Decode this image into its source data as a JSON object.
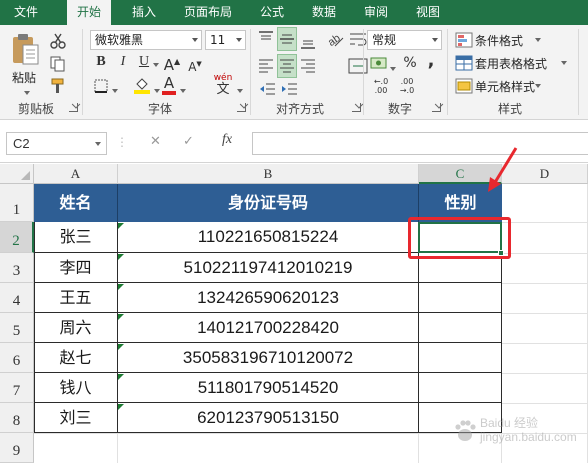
{
  "ribbon_tabs": [
    "文件",
    "开始",
    "插入",
    "页面布局",
    "公式",
    "数据",
    "审阅",
    "视图"
  ],
  "active_tab": "开始",
  "clipboard": {
    "paste": "粘贴",
    "group": "剪贴板"
  },
  "font": {
    "name": "微软雅黑",
    "size": "11",
    "bold": "B",
    "italic": "I",
    "underline": "U",
    "grow": "A",
    "shrink": "A",
    "wen": "wén",
    "wen_char": "文",
    "group": "字体"
  },
  "alignment": {
    "group": "对齐方式"
  },
  "number": {
    "format": "常规",
    "percent": "%",
    "comma": ",",
    "group": "数字"
  },
  "styles": {
    "conditional": "条件格式",
    "table": "套用表格格式",
    "cell": "单元格样式",
    "group": "样式"
  },
  "name_box": "C2",
  "formula_buttons": {
    "cancel": "✕",
    "enter": "✓",
    "fx": "fx"
  },
  "columns": [
    "A",
    "B",
    "C",
    "D"
  ],
  "rows": [
    "1",
    "2",
    "3",
    "4",
    "5",
    "6",
    "7",
    "8",
    "9"
  ],
  "table": {
    "headers": [
      "姓名",
      "身份证号码",
      "性别"
    ],
    "records": [
      {
        "name": "张三",
        "id": "110221650815224",
        "gender": ""
      },
      {
        "name": "李四",
        "id": "510221197412010219",
        "gender": ""
      },
      {
        "name": "王五",
        "id": "132426590620123",
        "gender": ""
      },
      {
        "name": "周六",
        "id": "140121700228420",
        "gender": ""
      },
      {
        "name": "赵七",
        "id": "350583196710120072",
        "gender": ""
      },
      {
        "name": "钱八",
        "id": "511801790514520",
        "gender": ""
      },
      {
        "name": "刘三",
        "id": "620123790513150",
        "gender": ""
      }
    ]
  },
  "watermark": "Baidu 经验 jingyan.baidu.com",
  "colors": {
    "excel_green": "#217346",
    "header_fill": "#2e5e94",
    "annotation_red": "#e8282e"
  }
}
